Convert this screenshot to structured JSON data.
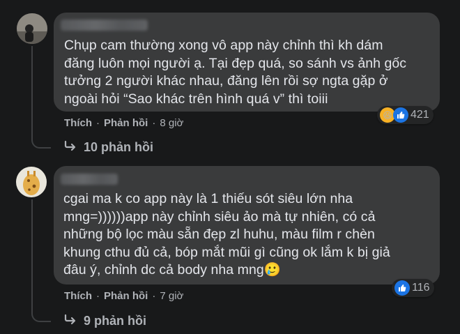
{
  "comments": [
    {
      "text": "Chụp cam thường xong vô app này chỉnh thì kh dám\nđăng luôn mọi người ạ. Tại đẹp quá, so sánh vs ảnh gốc\ntưởng 2 người khác nhau, đăng lên rồi sợ ngta gặp ở\nngoài hỏi “Sao khác trên hình quá v” thì toiii",
      "like_label": "Thích",
      "reply_label": "Phản hồi",
      "time": "8 giờ",
      "reaction_count": "421",
      "replies_label": "10 phản hồi"
    },
    {
      "text": "cgai ma k co app này là 1 thiếu sót siêu lớn nha\nmng=))))))app này chỉnh siêu ảo mà tự nhiên, có cả\nnhững bộ lọc màu sẵn đẹp zl huhu, màu film r chèn\nkhung cthu đủ cả, bóp mắt mũi gì cũng ok lắm k bị giả\nđâu ý, chỉnh dc cả body nha mng🥲",
      "like_label": "Thích",
      "reply_label": "Phản hồi",
      "time": "7 giờ",
      "reaction_count": "116",
      "replies_label": "9 phản hồi"
    }
  ],
  "separator": "·",
  "colors": {
    "background": "#18191a",
    "bubble": "#3a3b3c",
    "secondary_text": "#b0b3b8",
    "like_blue": "#1b74e4"
  }
}
